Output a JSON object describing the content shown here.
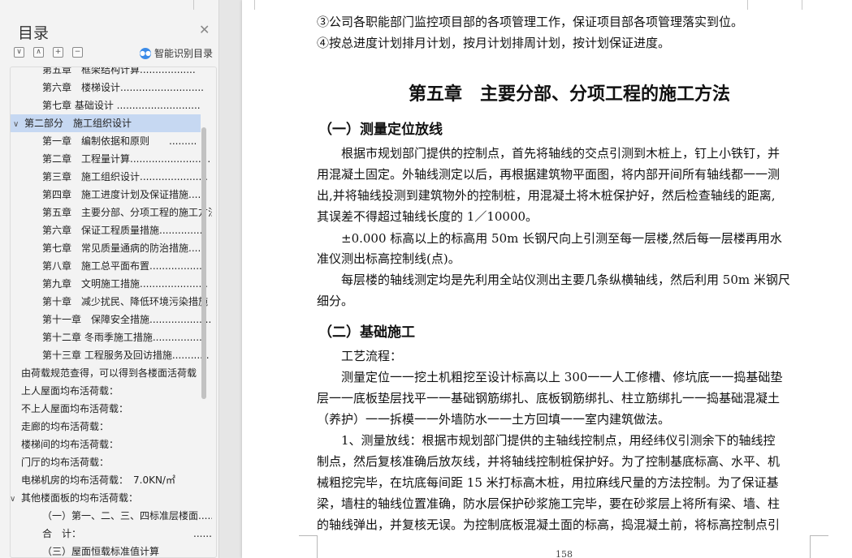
{
  "sidebar": {
    "title": "目录",
    "smart_label": "智能识别目录",
    "controls": [
      "∨",
      "∧",
      "+",
      "−"
    ],
    "items": [
      {
        "label": "第五章　框架结构计算..................",
        "level": 2
      },
      {
        "label": "第六章　楼梯设计...........................",
        "level": 2
      },
      {
        "label": "第七章  基础设计  ...........................",
        "level": 2
      },
      {
        "label": "第二部分　施工组织设计",
        "level": 1,
        "selected": true,
        "expanded": true
      },
      {
        "label": "第一章　编制依据和原则　　.........",
        "level": 2
      },
      {
        "label": "第二章　工程量计算..........................",
        "level": 2
      },
      {
        "label": "第三章　施工组织设计......................",
        "level": 2
      },
      {
        "label": "第四章　施工进度计划及保证措施......",
        "level": 2
      },
      {
        "label": "第五章　主要分部、分项工程的施工方法",
        "level": 2
      },
      {
        "label": "第六章　保证工程质量措施..............",
        "level": 2
      },
      {
        "label": "第七章　常见质量通病的防治措施......",
        "level": 2
      },
      {
        "label": "第八章　施工总平面布置..................",
        "level": 2
      },
      {
        "label": "第九章　文明施工措施......................",
        "level": 2
      },
      {
        "label": "第十章　减少扰民、降低环境污染措施",
        "level": 2
      },
      {
        "label": "第十一章　保障安全措施....................",
        "level": 2
      },
      {
        "label": "第十二章  冬雨季施工措施................",
        "level": 2
      },
      {
        "label": "第十三章  工程服务及回访措施............",
        "level": 2
      },
      {
        "label": "由荷载规范查得，可以得到各楼面活荷载",
        "level": 0
      },
      {
        "label": "上人屋面均布活荷载：",
        "level": 0
      },
      {
        "label": "不上人屋面均布活荷载：",
        "level": 0
      },
      {
        "label": "走廊的均布活荷载：",
        "level": 0
      },
      {
        "label": "楼梯间的均布活荷载：",
        "level": 0
      },
      {
        "label": "门厅的均布活荷载：",
        "level": 0
      },
      {
        "label": "电梯机房的均布活荷载：　7.0KN/㎡",
        "level": 0
      },
      {
        "label": "其他楼面板的均布活荷载：",
        "level": 0,
        "expanded": true
      },
      {
        "label": "（一）第一、二、三、四标准层楼面......",
        "level": 2
      },
      {
        "label": "合　计：　　　　　　　　　　　　......",
        "level": 2
      },
      {
        "label": "（三）屋面恒载标准值计算",
        "level": 2
      }
    ]
  },
  "document": {
    "lines": [
      "③公司各职能部门监控项目部的各项管理工作，保证项目部各项管理落实到位。",
      "④按总进度计划排月计划，按月计划排周计划，按计划保证进度。"
    ],
    "chapter_title": "第五章　主要分部、分项工程的施工方法",
    "section1": "（一）测量定位放线",
    "s1_lines": [
      "　　根据市规划部门提供的控制点，首先将轴线的交点引测到木桩上，钉上小铁钉，并",
      "用混凝土固定。外轴线测定以后，再根据建筑物平面图，将内部开间所有轴线都一一测",
      "出,并将轴线投测到建筑物外的控制桩，用混凝土将木桩保护好，然后检查轴线的距离,",
      "其误差不得超过轴线长度的 1／10000。",
      "　　±0.000 标高以上的标高用 50m 长钢尺向上引测至每一层楼,然后每一层楼再用水",
      "准仪测出标高控制线(点)。",
      "　　每层楼的轴线测定均是先利用全站仪测出主要几条纵横轴线，然后利用 50m 米钢尺",
      "细分。"
    ],
    "section2": "（二）基础施工",
    "s2_lines": [
      "　　工艺流程：",
      "　　测量定位一一挖土机粗挖至设计标高以上 300一一人工修槽、修坑底一一捣基础垫",
      "层一一底板垫层找平一一基础钢筋绑扎、底板钢筋绑扎、柱立筋绑扎一一捣基础混凝土",
      "（养护）一一拆模一一外墙防水一一土方回填一一室内建筑做法。",
      "　　1、测量放线：根据市规划部门提供的主轴线控制点，用经纬仪引测余下的轴线控",
      "制点，然后复核准确后放灰线，并将轴线控制桩保护好。为了控制基底标高、水平、机",
      "械粗挖完毕，在坑底每间距 15 米打标高木桩，用拉麻线尺量的方法控制。为了保证基",
      "梁，墙柱的轴线位置准确，防水层保护砂浆施工完毕，要在砂浆层上将所有梁、墙、柱",
      "的轴线弹出，并复核无误。为控制底板混凝土面的标高，捣混凝土前，将标高控制点引"
    ],
    "page_number": "158"
  }
}
